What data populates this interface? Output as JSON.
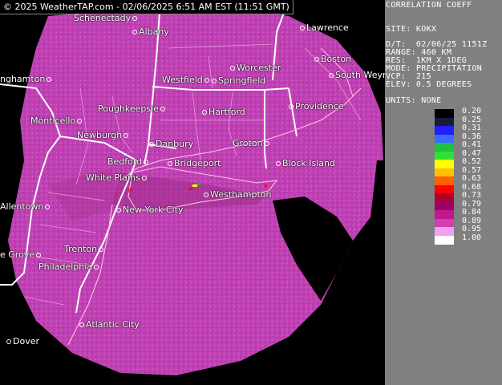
{
  "banner": "© 2025 WeatherTAP.com - 02/06/2025 6:51 AM EST (11:51 GMT)",
  "panel": {
    "title": "CORRELATION COEFF",
    "site": "SITE: KOKX",
    "dt": "D/T:  02/06/25 1151Z",
    "range": "RANGE: 460 KM",
    "res": "RES:  1KM X 1DEG",
    "mode": "MODE: PRECIPITATION",
    "vcp": "VCP:  215",
    "elev": "ELEV: 0.5 DEGREES",
    "units": "UNITS: NONE"
  },
  "scale": {
    "values": [
      "0.20",
      "0.25",
      "0.31",
      "0.36",
      "0.41",
      "0.47",
      "0.52",
      "0.57",
      "0.63",
      "0.68",
      "0.73",
      "0.79",
      "0.84",
      "0.89",
      "0.95",
      "1.00"
    ],
    "colors": [
      "#000000",
      "#1a1a3a",
      "#2020ff",
      "#3a6aff",
      "#20c040",
      "#30e030",
      "#ffff00",
      "#ffc000",
      "#ff6000",
      "#ff0000",
      "#b00030",
      "#a00060",
      "#c01890",
      "#d040b0",
      "#f0a0f0",
      "#ffffff"
    ]
  },
  "cities": [
    {
      "name": "Schenectady",
      "dotLeft": false
    },
    {
      "name": "Albany",
      "dotLeft": true
    },
    {
      "name": "Lawrence",
      "dotLeft": true
    },
    {
      "name": "Worcester",
      "dotLeft": true
    },
    {
      "name": "Boston",
      "dotLeft": true
    },
    {
      "name": "Westfield",
      "dotLeft": false
    },
    {
      "name": "Springfield",
      "dotLeft": true
    },
    {
      "name": "South Weymouth",
      "dotLeft": true
    },
    {
      "name": "Providence",
      "dotLeft": true
    },
    {
      "name": "Hartford",
      "dotLeft": true
    },
    {
      "name": "Poughkeepsie",
      "dotLeft": false
    },
    {
      "name": "Monticello",
      "dotLeft": false
    },
    {
      "name": "Newburgh",
      "dotLeft": false
    },
    {
      "name": "Danbury",
      "dotLeft": true
    },
    {
      "name": "Groton",
      "dotLeft": false
    },
    {
      "name": "Bedford",
      "dotLeft": false
    },
    {
      "name": "Bridgeport",
      "dotLeft": true
    },
    {
      "name": "Block Island",
      "dotLeft": true
    },
    {
      "name": "White Plains",
      "dotLeft": false
    },
    {
      "name": "Westhampton",
      "dotLeft": true
    },
    {
      "name": "New York City",
      "dotLeft": true
    },
    {
      "name": "Allentown",
      "dotLeft": false
    },
    {
      "name": "Trenton",
      "dotLeft": false
    },
    {
      "name": "Philadelphia",
      "dotLeft": false
    },
    {
      "name": "Atlantic City",
      "dotLeft": true
    },
    {
      "name": "Dover",
      "dotLeft": true
    },
    {
      "name": "nghamton",
      "dotLeft": false
    },
    {
      "name": "e Grove",
      "dotLeft": false
    }
  ]
}
